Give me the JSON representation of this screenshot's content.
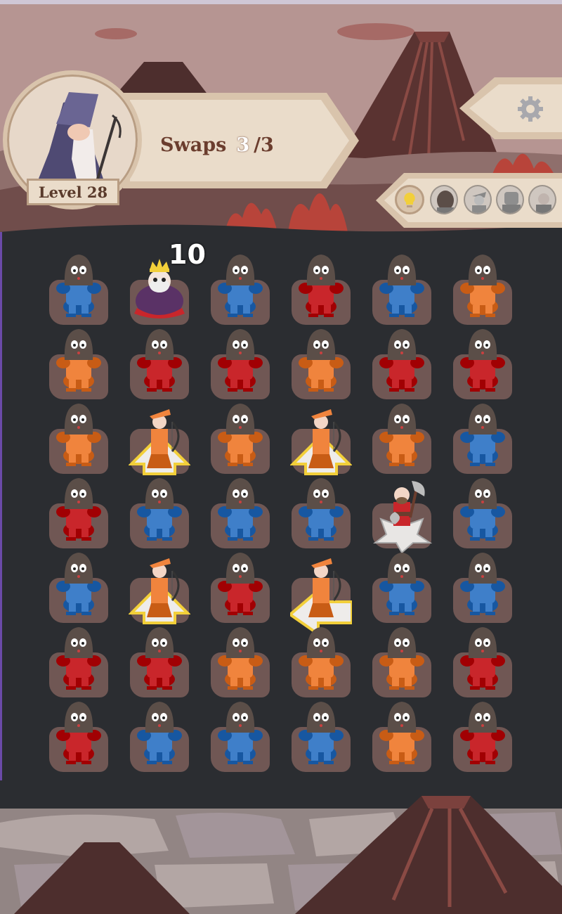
{
  "hud": {
    "level_label": "Level 28",
    "swaps_label": "Swaps",
    "swaps_current": "3",
    "swaps_total": "/3",
    "settings_icon": "gear-icon",
    "hint_icon": "lightbulb-icon",
    "enemy_icons": [
      "dwarf-enemy-icon",
      "ranger-enemy-icon",
      "knight-enemy-icon",
      "barbarian-enemy-icon"
    ]
  },
  "score_popup": "10",
  "colors": {
    "blue": "#3f7fc9",
    "red": "#c9262b",
    "orange": "#f0843d",
    "gold": "#f2cf3a",
    "sky": "#b69592",
    "volcano": "#5a3331",
    "lava": "#b8443a",
    "board": "#2b2d31",
    "tile_base": "#705754",
    "parchment": "#eadcca"
  },
  "board": {
    "rows": 7,
    "cols": 6,
    "cells": [
      [
        "blue",
        "king",
        "blue",
        "red",
        "blue",
        "orange"
      ],
      [
        "orange",
        "red",
        "red",
        "orange",
        "red",
        "red"
      ],
      [
        "orange",
        "archer-up",
        "orange",
        "archer-up",
        "orange",
        "blue"
      ],
      [
        "red",
        "blue",
        "blue",
        "blue",
        "axeman-cross",
        "blue"
      ],
      [
        "blue",
        "archer-up",
        "red",
        "archer-left",
        "blue",
        "blue"
      ],
      [
        "red",
        "red",
        "orange",
        "orange",
        "orange",
        "red"
      ],
      [
        "red",
        "blue",
        "blue",
        "blue",
        "orange",
        "red"
      ]
    ]
  }
}
